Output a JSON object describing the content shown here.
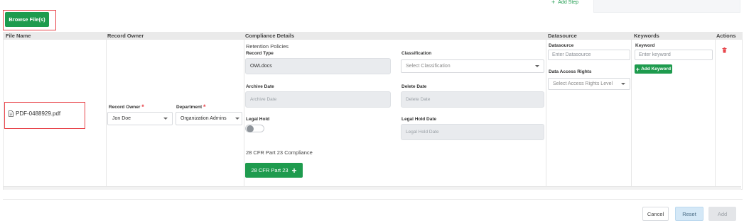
{
  "top": {
    "add_step_label": "Add Step",
    "browse_label": "Browse File(s)"
  },
  "table": {
    "headers": [
      "File Name",
      "Record Owner",
      "Compliance Details",
      "Datasource",
      "Keywords",
      "Actions"
    ]
  },
  "row": {
    "file_name": "PDF-0488929.pdf",
    "record_owner": {
      "owner_label": "Record Owner",
      "owner_value": "Jon Doe",
      "department_label": "Department",
      "department_value": "Organization Admins"
    },
    "compliance": {
      "section_title": "Retention Policies",
      "record_type_label": "Record Type",
      "record_type_value": "OWLdocs",
      "classification_label": "Classification",
      "classification_placeholder": "Select Classification",
      "archive_date_label": "Archive Date",
      "archive_date_placeholder": "Archive Date",
      "delete_date_label": "Delete Date",
      "delete_date_placeholder": "Delete Date",
      "legal_hold_label": "Legal Hold",
      "legal_hold_on": false,
      "legal_hold_date_label": "Legal Hold Date",
      "legal_hold_date_placeholder": "Legal Hold Date",
      "cfr_title": "28 CFR Part 23 Compliance",
      "cfr_button": "28 CFR Part 23"
    },
    "datasource": {
      "label": "Datasource",
      "placeholder": "Enter Datasource",
      "access_label": "Data Access Rights",
      "access_placeholder": "Select Access Rights Level"
    },
    "keywords": {
      "label": "Keyword",
      "placeholder": "Enter keyword",
      "add_button": "Add Keyword"
    }
  },
  "footer": {
    "cancel": "Cancel",
    "reset": "Reset",
    "add": "Add"
  },
  "colors": {
    "primary_green": "#1e9b4e",
    "highlight_red": "#e8464c",
    "required_red": "#e8464c"
  }
}
